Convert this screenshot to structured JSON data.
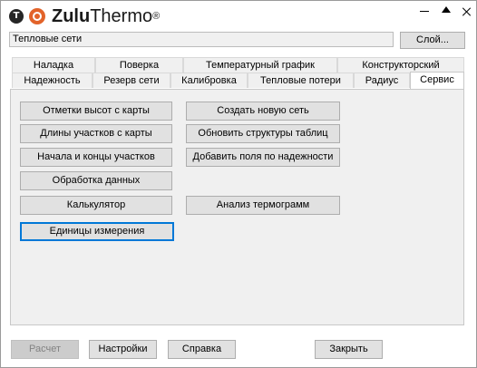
{
  "app": {
    "title_part_a": "Zulu",
    "title_part_b": "Thermo",
    "registered": "®",
    "logo_letter": "T"
  },
  "layer": {
    "value": "Тепловые сети",
    "button_label": "Слой..."
  },
  "tabs_row1": [
    "Наладка",
    "Поверка",
    "Температурный график",
    "Конструкторский"
  ],
  "tabs_row2": [
    "Надежность",
    "Резерв сети",
    "Калибровка",
    "Тепловые потери",
    "Радиус",
    "Сервис"
  ],
  "active_tab": "Сервис",
  "service": {
    "left": [
      "Отметки высот с карты",
      "Длины участков с карты",
      "Начала и концы участков",
      "Обработка данных",
      "Калькулятор",
      "Единицы измерения"
    ],
    "right": [
      "Создать новую сеть",
      "Обновить структуры таблиц",
      "Добавить поля по надежности",
      "Анализ термограмм"
    ]
  },
  "footer": {
    "calc": "Расчет",
    "settings": "Настройки",
    "help": "Справка",
    "close": "Закрыть"
  },
  "colors": {
    "accent": "#0078d7",
    "logo_orange": "#e2632a",
    "panel_bg": "#f0f0f0"
  }
}
